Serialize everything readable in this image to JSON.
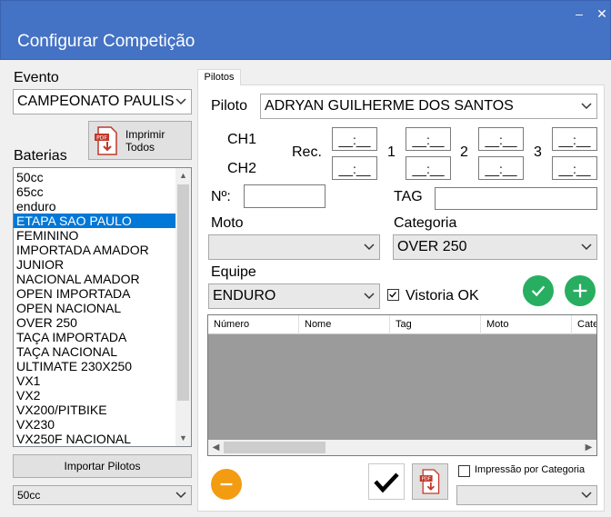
{
  "window": {
    "title": "Configurar Competição",
    "minimize": "–",
    "close": "✕"
  },
  "left": {
    "evento_label": "Evento",
    "evento_value": "CAMPEONATO PAULIS",
    "imprimir_label": "Imprimir Todos",
    "baterias_label": "Baterias",
    "baterias": [
      "50cc",
      "65cc",
      "enduro",
      "ETAPA SAO PAULO",
      "FEMININO",
      "IMPORTADA AMADOR",
      "JUNIOR",
      "NACIONAL AMADOR",
      "OPEN IMPORTADA",
      "OPEN NACIONAL",
      "OVER 250",
      "TAÇA IMPORTADA",
      "TAÇA NACIONAL",
      "ULTIMATE 230X250",
      "VX1",
      "VX2",
      "VX200/PITBIKE",
      "VX230",
      "VX250F NACIONAL"
    ],
    "baterias_selected": 3,
    "importar_label": "Importar Pilotos",
    "bottom_combo_value": "50cc"
  },
  "tab": {
    "label": "Pilotos"
  },
  "form": {
    "piloto_label": "Piloto",
    "piloto_value": "ADRYAN GUILHERME DOS SANTOS",
    "ch1_label": "CH1",
    "ch2_label": "CH2",
    "rec_label": "Rec.",
    "time_mask": "__:__",
    "n1": "1",
    "n2": "2",
    "n3": "3",
    "numero_label": "Nº:",
    "tag_label": "TAG",
    "moto_label": "Moto",
    "moto_value": "",
    "categoria_label": "Categoria",
    "categoria_value": "OVER 250",
    "equipe_label": "Equipe",
    "equipe_value": "ENDURO",
    "vistoria_label": "Vistoria OK",
    "vistoria_checked": true
  },
  "grid": {
    "columns": [
      "Número",
      "Nome",
      "Tag",
      "Moto",
      "Cate"
    ]
  },
  "bottom": {
    "impressao_label": "Impressão por Categoria",
    "impressao_combo_value": ""
  },
  "colors": {
    "accent": "#4472c4",
    "green": "#27ae60",
    "orange": "#f39c12",
    "selection": "#0078d7"
  }
}
